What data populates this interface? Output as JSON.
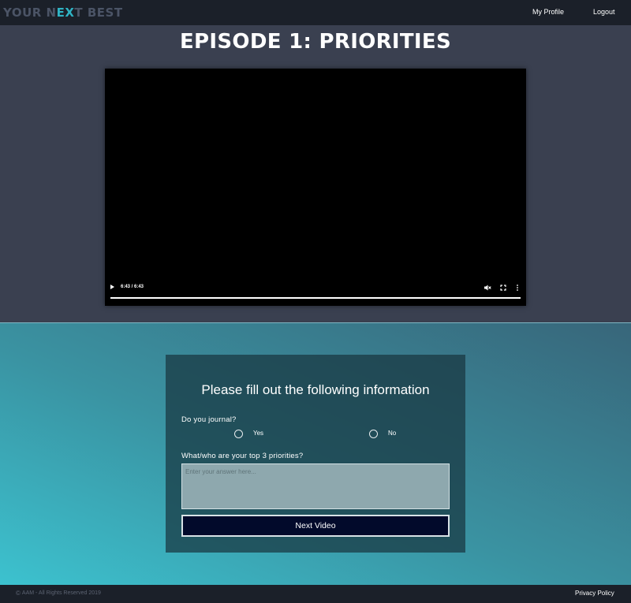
{
  "app": {
    "logo_text_a": "YOUR N",
    "logo_mark": "EX",
    "logo_text_b": "T BEST"
  },
  "nav": {
    "profile_label": "My Profile",
    "logout_label": "Logout"
  },
  "episode": {
    "title": "EPISODE 1: PRIORITIES"
  },
  "video": {
    "time": "6:43 / 6:43",
    "progress": 1.0,
    "icons": [
      "play-icon",
      "mute-icon",
      "fullscreen-icon",
      "more-options-icon"
    ]
  },
  "form": {
    "heading": "Please fill out the following information",
    "question_journal": "Do you journal?",
    "option_yes": "Yes",
    "option_no": "No",
    "question_priorities": "What/who are your top 3 priorities?",
    "answer_placeholder": "Enter your answer here...",
    "answer_value": "",
    "next_button": "Next Video"
  },
  "footer": {
    "copyright_symbol": "©",
    "copyright": "AAM - All Rights Reserved 2019",
    "privacy": "Privacy Policy"
  },
  "colors": {
    "nav_bg": "#1b2029",
    "hero_bg": "#3a4050",
    "accent": "#2fb3c4",
    "button_bg": "#020a2b"
  }
}
